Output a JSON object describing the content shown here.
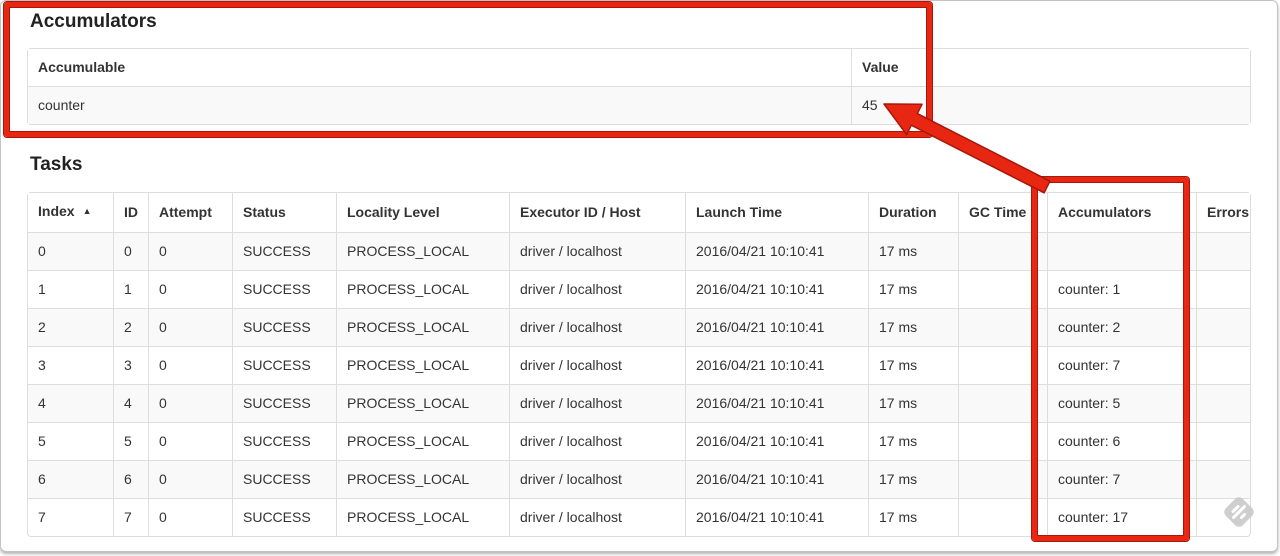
{
  "accumulators_section": {
    "title": "Accumulators",
    "table": {
      "headers": [
        {
          "label": "Accumulable",
          "sortable": false
        },
        {
          "label": "Value",
          "sortable": false
        }
      ],
      "rows": [
        [
          "counter",
          "45"
        ]
      ]
    }
  },
  "tasks_section": {
    "title": "Tasks",
    "table": {
      "headers": [
        {
          "label": "Index",
          "sortable": true,
          "sort_icon": "▲"
        },
        {
          "label": "ID",
          "sortable": true
        },
        {
          "label": "Attempt",
          "sortable": true
        },
        {
          "label": "Status",
          "sortable": true
        },
        {
          "label": "Locality Level",
          "sortable": true
        },
        {
          "label": "Executor ID / Host",
          "sortable": true
        },
        {
          "label": "Launch Time",
          "sortable": true
        },
        {
          "label": "Duration",
          "sortable": true
        },
        {
          "label": "GC Time",
          "sortable": true
        },
        {
          "label": "Accumulators",
          "sortable": true
        },
        {
          "label": "Errors",
          "sortable": true
        }
      ],
      "rows": [
        [
          "0",
          "0",
          "0",
          "SUCCESS",
          "PROCESS_LOCAL",
          "driver / localhost",
          "2016/04/21 10:10:41",
          "17 ms",
          "",
          "",
          ""
        ],
        [
          "1",
          "1",
          "0",
          "SUCCESS",
          "PROCESS_LOCAL",
          "driver / localhost",
          "2016/04/21 10:10:41",
          "17 ms",
          "",
          "counter: 1",
          ""
        ],
        [
          "2",
          "2",
          "0",
          "SUCCESS",
          "PROCESS_LOCAL",
          "driver / localhost",
          "2016/04/21 10:10:41",
          "17 ms",
          "",
          "counter: 2",
          ""
        ],
        [
          "3",
          "3",
          "0",
          "SUCCESS",
          "PROCESS_LOCAL",
          "driver / localhost",
          "2016/04/21 10:10:41",
          "17 ms",
          "",
          "counter: 7",
          ""
        ],
        [
          "4",
          "4",
          "0",
          "SUCCESS",
          "PROCESS_LOCAL",
          "driver / localhost",
          "2016/04/21 10:10:41",
          "17 ms",
          "",
          "counter: 5",
          ""
        ],
        [
          "5",
          "5",
          "0",
          "SUCCESS",
          "PROCESS_LOCAL",
          "driver / localhost",
          "2016/04/21 10:10:41",
          "17 ms",
          "",
          "counter: 6",
          ""
        ],
        [
          "6",
          "6",
          "0",
          "SUCCESS",
          "PROCESS_LOCAL",
          "driver / localhost",
          "2016/04/21 10:10:41",
          "17 ms",
          "",
          "counter: 7",
          ""
        ],
        [
          "7",
          "7",
          "0",
          "SUCCESS",
          "PROCESS_LOCAL",
          "driver / localhost",
          "2016/04/21 10:10:41",
          "17 ms",
          "",
          "counter: 17",
          ""
        ]
      ]
    }
  },
  "annotations": {
    "highlight_color": "#e82712",
    "arrow_icon": "arrow-up-left"
  },
  "watermark_icon": "skitch-diamond-icon"
}
